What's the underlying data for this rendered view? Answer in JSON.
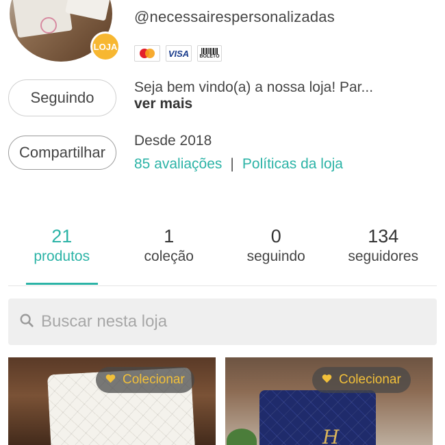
{
  "store": {
    "handle": "@necessairespersonalizadas",
    "badge": "LOJA",
    "payments": [
      {
        "name": "mastercard-icon",
        "label": "MasterCard"
      },
      {
        "name": "visa-icon",
        "label": "VISA"
      },
      {
        "name": "boleto-icon",
        "label": "BOLETO"
      }
    ],
    "description": "Seja bem vindo(a) a nossa loja! Par...",
    "more_label": "ver mais",
    "since": "Desde 2018",
    "reviews_link": "85 avaliações",
    "separator": "|",
    "policies_link": "Políticas da loja"
  },
  "actions": {
    "follow_label": "Seguindo",
    "share_label": "Compartilhar"
  },
  "stats": [
    {
      "number": "21",
      "label": "produtos",
      "active": true
    },
    {
      "number": "1",
      "label": "coleção",
      "active": false
    },
    {
      "number": "0",
      "label": "seguindo",
      "active": false
    },
    {
      "number": "134",
      "label": "seguidores",
      "active": false
    }
  ],
  "search": {
    "placeholder": "Buscar nesta loja"
  },
  "products": [
    {
      "collect_label": "Colecionar",
      "monogram": ""
    },
    {
      "collect_label": "Colecionar",
      "monogram": "H"
    }
  ],
  "colors": {
    "accent": "#2bb3a6",
    "badge": "#f7b731",
    "collect_text": "#f2c03a"
  }
}
